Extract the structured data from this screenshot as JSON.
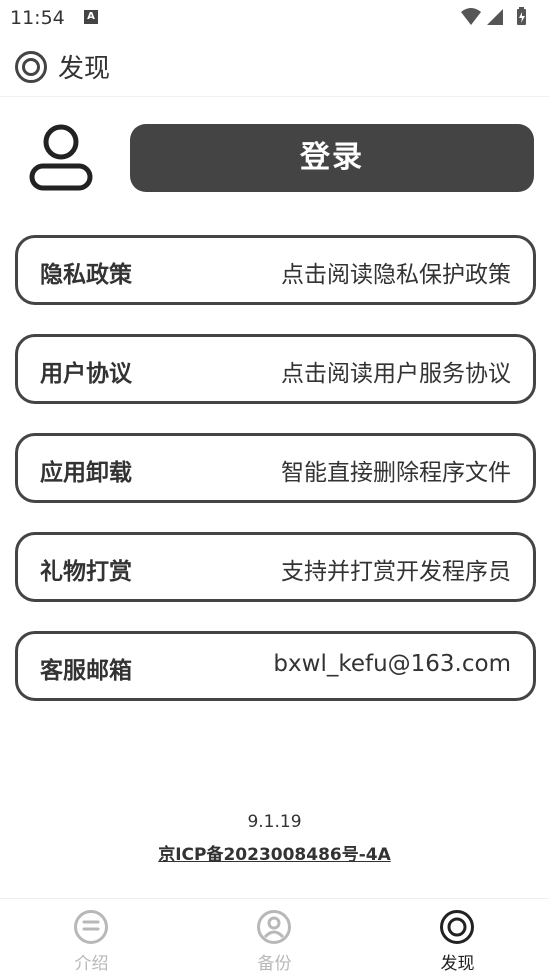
{
  "status_bar": {
    "time": "11:54",
    "notif_letter": "A"
  },
  "header": {
    "title": "发现"
  },
  "login": {
    "label": "登录"
  },
  "menu": [
    {
      "label": "隐私政策",
      "desc": "点击阅读隐私保护政策"
    },
    {
      "label": "用户协议",
      "desc": "点击阅读用户服务协议"
    },
    {
      "label": "应用卸载",
      "desc": "智能直接删除程序文件"
    },
    {
      "label": "礼物打赏",
      "desc": "支持并打赏开发程序员"
    },
    {
      "label": "客服邮箱",
      "desc": "bxwl_kefu@163.com"
    }
  ],
  "footer": {
    "version": "9.1.19",
    "icp": "京ICP备2023008486号-4A"
  },
  "nav": [
    {
      "label": "介绍",
      "icon": "menu-circle-icon",
      "active": false
    },
    {
      "label": "备份",
      "icon": "user-circle-icon",
      "active": false
    },
    {
      "label": "发现",
      "icon": "target-circle-icon",
      "active": true
    }
  ],
  "colors": {
    "accent": "#444444",
    "inactive": "#b8b8b8",
    "text": "#333333"
  }
}
